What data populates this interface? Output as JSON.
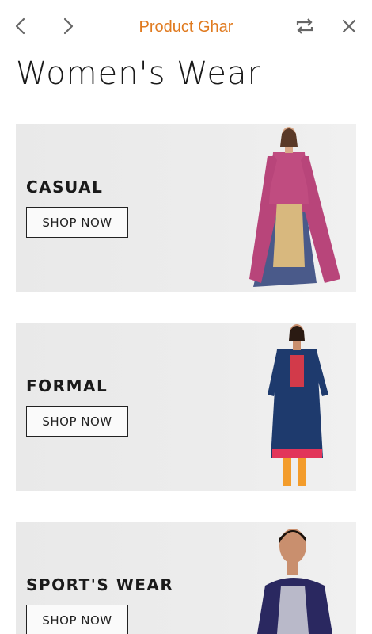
{
  "header": {
    "title": "Product Ghar",
    "back_icon": "chevron-left-icon",
    "forward_icon": "chevron-right-icon",
    "share_icon": "repeat-icon",
    "close_icon": "close-icon",
    "accent_color": "#e07a1f"
  },
  "page": {
    "title": "Women's Wear"
  },
  "categories": [
    {
      "label": "CASUAL",
      "button": "SHOP NOW"
    },
    {
      "label": "FORMAL",
      "button": "SHOP NOW"
    },
    {
      "label": "SPORT'S WEAR",
      "button": "SHOP NOW"
    }
  ]
}
